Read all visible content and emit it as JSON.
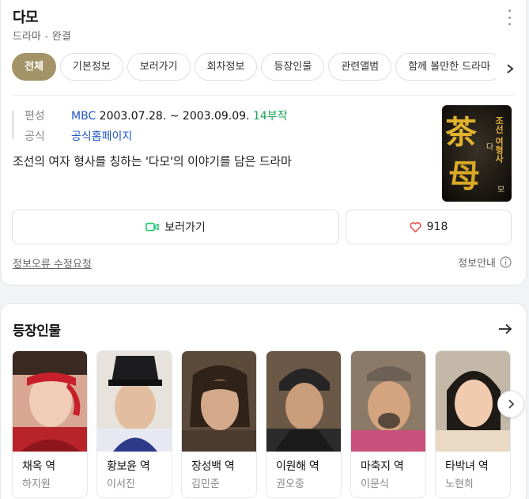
{
  "header": {
    "title": "다모",
    "genre": "드라마",
    "status": "완결"
  },
  "tabs": [
    "전체",
    "기본정보",
    "보러가기",
    "회차정보",
    "등장인물",
    "관련앨범",
    "함께 볼만한 드라마"
  ],
  "info": {
    "broadcast_label": "편성",
    "channel": "MBC",
    "period": "2003.07.28. ~ 2003.09.09.",
    "episodes": "14부작",
    "official_label": "공식",
    "official_link": "공식홈페이지",
    "description": "조선의 여자 형사를 칭하는 '다모'의 이야기를 담은 드라마"
  },
  "poster": {
    "main_chars": "茶母",
    "side_text": "조선 여형사",
    "small1": "다",
    "small2": "모"
  },
  "actions": {
    "watch_label": "보러가기",
    "like_count": "918"
  },
  "footer": {
    "report_label": "정보오류 수정요청",
    "guide_label": "정보안내"
  },
  "characters_section": {
    "title": "등장인물",
    "items": [
      {
        "role": "채옥 역",
        "actor": "하지원"
      },
      {
        "role": "황보윤 역",
        "actor": "이서진"
      },
      {
        "role": "장성백 역",
        "actor": "김민준"
      },
      {
        "role": "이원해 역",
        "actor": "권오중"
      },
      {
        "role": "마축지 역",
        "actor": "이문식"
      },
      {
        "role": "타박녀 역",
        "actor": "노현희"
      }
    ]
  },
  "colors": {
    "active_tab": "#a39467",
    "link_blue": "#2055c8",
    "episode_green": "#1aa35a",
    "watch_icon_green": "#1ec86e",
    "heart_red": "#f04848"
  },
  "icons": {
    "more": "more-vertical-icon",
    "tab_next": "chevron-right-icon",
    "watch": "video-camera-icon",
    "like": "heart-icon",
    "info": "info-circle-icon",
    "section_more": "arrow-right-icon",
    "scroll_next": "chevron-right-icon"
  }
}
